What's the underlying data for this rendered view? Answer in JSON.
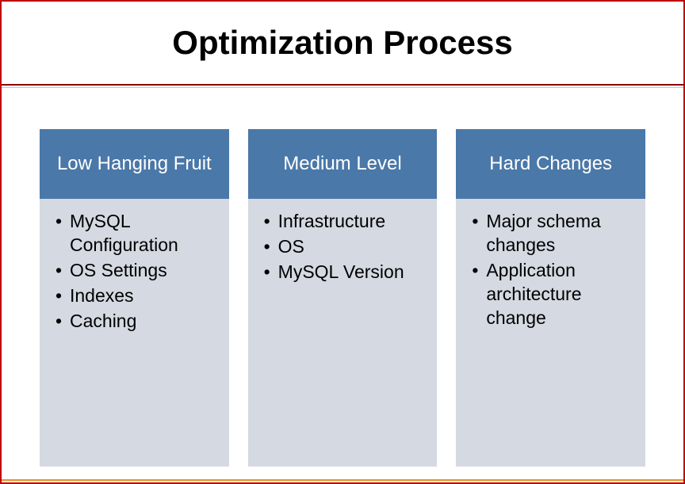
{
  "title": "Optimization Process",
  "columns": [
    {
      "header": "Low Hanging Fruit",
      "items": [
        "MySQL Configuration",
        "OS Settings",
        "Indexes",
        "Caching"
      ]
    },
    {
      "header": "Medium Level",
      "items": [
        "Infrastructure",
        "OS",
        "MySQL Version"
      ]
    },
    {
      "header": "Hard Changes",
      "items": [
        "Major schema changes",
        "Application architecture change"
      ]
    }
  ]
}
